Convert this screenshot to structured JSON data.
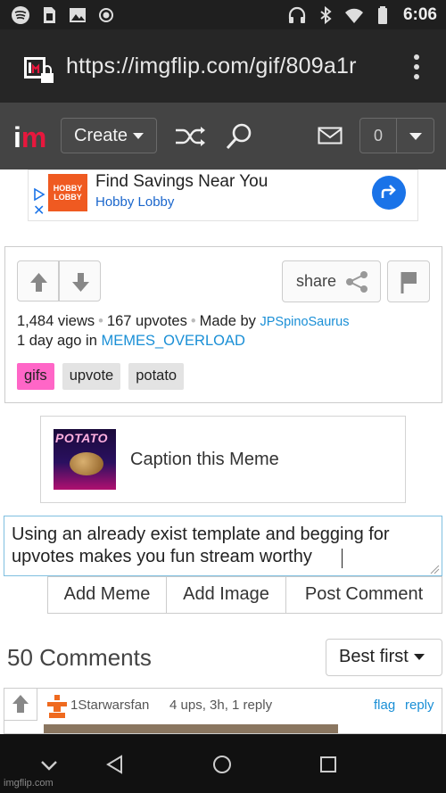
{
  "status_bar": {
    "time": "6:06",
    "icons_left": [
      "spotify-icon",
      "sim-card-icon",
      "image-icon",
      "record-icon"
    ],
    "icons_right": [
      "headphones-icon",
      "bluetooth-icon",
      "wifi-icon",
      "battery-icon"
    ]
  },
  "browser": {
    "url": "https://imgflip.com/gif/809a1r",
    "icons": [
      "lock-icon",
      "kebab-menu-icon"
    ]
  },
  "nav": {
    "logo_i": "i",
    "logo_m": "m",
    "create_label": "Create",
    "notification_count": "0",
    "icons": [
      "shuffle-icon",
      "search-icon",
      "mail-icon",
      "chevron-down-icon"
    ]
  },
  "ad": {
    "brand_logo": "HOBBY LOBBY",
    "title": "Find Savings Near You",
    "subtitle": "Hobby Lobby",
    "close": "✕",
    "icons": [
      "ad-choices-icon",
      "directions-arrow-icon"
    ]
  },
  "meme": {
    "share_label": "share",
    "views": "1,484 views",
    "upvotes": "167 upvotes",
    "made_by_prefix": "Made by",
    "author": "JPSpinoSaurus",
    "posted_prefix": "1 day ago in",
    "stream": "MEMES_OVERLOAD",
    "separator": "•",
    "tags": [
      "gifs",
      "upvote",
      "potato"
    ],
    "highlight_color": "#ff66c7"
  },
  "caption": {
    "thumb_text": "POTATO",
    "label": "Caption this Meme"
  },
  "comment_form": {
    "value": "Using an already exist template and begging for upvotes makes you fun stream worthy",
    "buttons": [
      "Add Meme",
      "Add Image",
      "Post Comment"
    ]
  },
  "comments": {
    "count_label": "50 Comments",
    "sort_label": "Best first",
    "first": {
      "user": "1Starwarsfan",
      "meta": "4 ups, 3h, 1 reply",
      "flag": "flag",
      "reply": "reply"
    }
  },
  "android_nav": {
    "icons": [
      "chevron-down-icon",
      "back-icon",
      "home-icon",
      "recents-icon"
    ]
  },
  "watermark": "imgflip.com",
  "colors": {
    "accent_red": "#e8173d",
    "link_blue": "#1a8fd6",
    "nav_bg": "#444444"
  }
}
